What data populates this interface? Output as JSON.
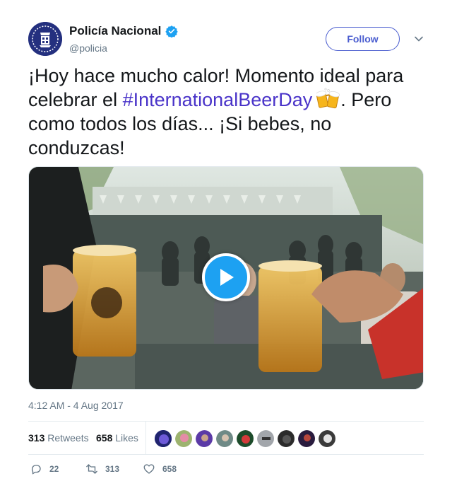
{
  "user": {
    "display_name": "Policía Nacional",
    "handle": "@policia",
    "verified": true
  },
  "follow_label": "Follow",
  "tweet": {
    "text_part1": "¡Hoy hace mucho calor! Momento ideal para celebrar el ",
    "hashtag": "#InternationalBeerDay",
    "text_part2": ". Pero como todos los días... ¡Si bebes, no conduzcas!",
    "emoji": "beer-mugs-icon"
  },
  "media": {
    "type": "video",
    "play_icon": "play-icon"
  },
  "timestamp": "4:12 AM - 4 Aug 2017",
  "stats": {
    "retweets_count": "313",
    "retweets_label": "Retweets",
    "likes_count": "658",
    "likes_label": "Likes",
    "liker_avatars": 9
  },
  "actions": {
    "replies": "22",
    "retweets": "313",
    "likes": "658"
  },
  "colors": {
    "accent": "#1da1f2",
    "hashtag": "#4a34c9",
    "follow": "#4a5dcf",
    "muted": "#657786"
  }
}
